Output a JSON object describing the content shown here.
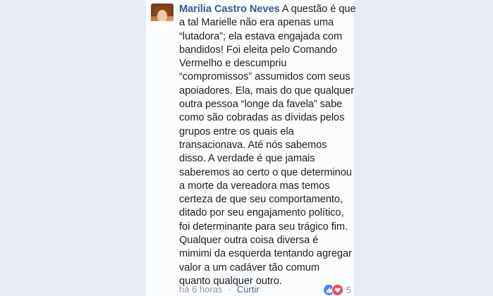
{
  "comment": {
    "author": "Marilia Castro Neves",
    "first_line": "A questão é que",
    "lines": [
      "a tal Marielle não era apenas uma",
      "“lutadora”; ela estava engajada com",
      "bandidos! Foi eleita pelo Comando",
      "Vermelho e descumpriu",
      "“compromissos” assumidos com seus",
      "apoiadores. Ela, mais do que qualquer",
      "outra pessoa “longe da favela” sabe",
      "como são cobradas as dívidas pelos",
      "grupos entre os quais ela",
      "transacionava. Até nós sabemos",
      "disso. A verdade é que jamais",
      "saberemos ao certo o que determinou",
      "a morte da vereadora mas temos",
      "certeza de que seu comportamento,",
      "ditado por seu engajamento político,",
      "foi determinante para seu trágico fim.",
      "Qualquer outra coisa diversa é",
      "mimimi da esquerda tentando agregar",
      "valor a um cadáver tão comum",
      "quanto qualquer outro."
    ]
  },
  "footer": {
    "timestamp": "há 6 horas",
    "separator": "·",
    "like_label": "Curtir",
    "reaction_count": "5",
    "reaction_icons": [
      "thumbs-up-icon",
      "heart-icon"
    ]
  },
  "colors": {
    "author": "#385898",
    "text": "#1c1e21",
    "meta": "#8f96a3",
    "like_reaction": "#4a7ef0",
    "love_reaction": "#ee4b5f",
    "background": "#e9eef4"
  }
}
